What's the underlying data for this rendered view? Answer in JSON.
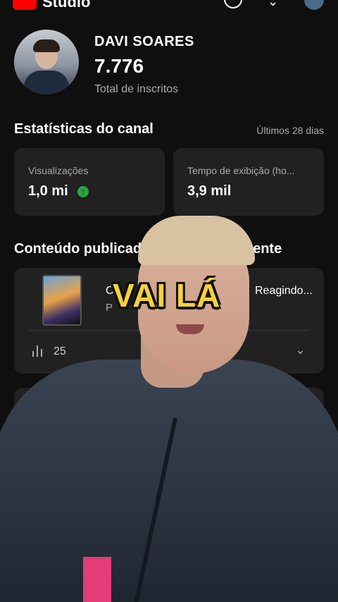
{
  "header": {
    "app_name": "Studio"
  },
  "profile": {
    "name": "DAVI SOARES",
    "subscribers": "7.776",
    "subscribers_label": "Total de inscritos"
  },
  "channel_stats": {
    "title": "Estatísticas do canal",
    "period": "Últimos 28 dias",
    "cards": [
      {
        "label": "Visualizações",
        "value": "1,0 mi",
        "trend": "up"
      },
      {
        "label": "Tempo de exibição (ho...",
        "value": "3,9 mil"
      }
    ]
  },
  "published_content": {
    "title": "Conteúdo publicad",
    "title_end": "ente",
    "items": [
      {
        "title_fragment_start": "C",
        "title_fragment_end": "Reagindo...",
        "subtitle_fragment": "P",
        "views_fragment": "25"
      }
    ]
  },
  "overlay": {
    "caption": "VAI LÁ"
  },
  "colors": {
    "background": "#0f0f0f",
    "card": "#212121",
    "accent_green": "#2ba640",
    "caption": "#f7d23c"
  }
}
